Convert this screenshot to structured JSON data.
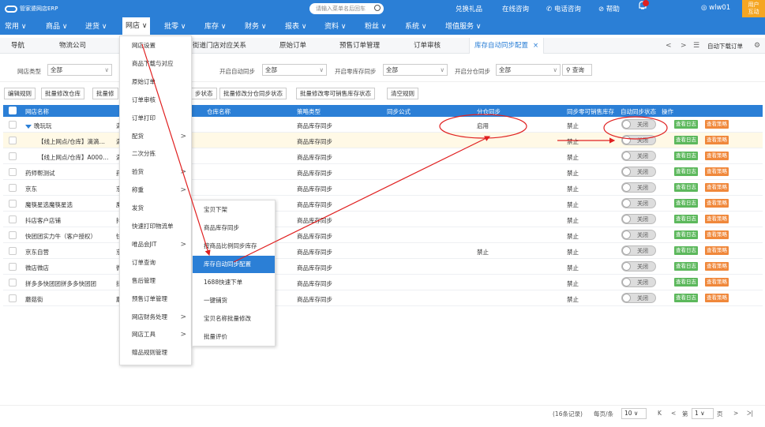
{
  "app": {
    "logo": "管家婆网店ERP"
  },
  "topbar": {
    "search_placeholder": "请输入菜单名后回车",
    "links": [
      "兑换礼品",
      "在线咨询",
      "电话咨询",
      "帮助"
    ],
    "user": "wlw01",
    "interact": [
      "用户",
      "互动"
    ]
  },
  "menu": [
    "常用",
    "商品",
    "进货",
    "网店",
    "批零",
    "库存",
    "财务",
    "报表",
    "资料",
    "粉丝",
    "系统",
    "增值服务"
  ],
  "tabs": [
    "导航",
    "物流公司",
    "街道门店对应关系",
    "原始订单",
    "预售订单管理",
    "订单审核",
    "库存自动同步配置"
  ],
  "tab_close": "×",
  "tab_controls": {
    "prev": "<",
    "next": ">",
    "list": "☰",
    "auto_download": "自动下载订单",
    "settings": "⚙"
  },
  "filters": [
    {
      "label": "网店类型",
      "value": "全部"
    },
    {
      "label": "开启自动同步",
      "value": "全部"
    },
    {
      "label": "开启零库存同步",
      "value": "全部"
    },
    {
      "label": "开启分仓同步",
      "value": "全部"
    }
  ],
  "query_label": "查询",
  "actions": [
    "编辑规则",
    "批量修改仓库",
    "批量修",
    "步状态",
    "批量修改分仓同步状态",
    "批量修改零可销售库存状态",
    "清空规则"
  ],
  "columns": [
    "网店名称",
    "仓库名称",
    "策略类型",
    "同步公式",
    "分仓同步",
    "同步零可销售库存",
    "自动同步状态",
    "操作"
  ],
  "rows": [
    {
      "name": "晚玩玩",
      "c2": "满",
      "strategy": "商品库存同步",
      "split": "启用",
      "zero": "禁止",
      "toggle": "关闭",
      "group": true
    },
    {
      "name": "【线上网点/仓库】滴滴…",
      "c2": "满",
      "strategy": "商品库存同步",
      "split": "",
      "zero": "禁止",
      "toggle": "关闭",
      "child": true
    },
    {
      "name": "【线上网点/仓库】A000…",
      "c2": "满",
      "strategy": "商品库存同步",
      "split": "",
      "zero": "禁止",
      "toggle": "关闭",
      "child": true
    },
    {
      "name": "药师帮测试",
      "c2": "药",
      "strategy": "商品库存同步",
      "split": "",
      "zero": "禁止",
      "toggle": "关闭"
    },
    {
      "name": "京东",
      "c2": "京",
      "strategy": "商品库存同步",
      "split": "",
      "zero": "禁止",
      "toggle": "关闭"
    },
    {
      "name": "魔筷星选魔筷星选",
      "c2": "魔",
      "strategy": "商品库存同步",
      "split": "",
      "zero": "禁止",
      "toggle": "关闭"
    },
    {
      "name": "抖店客户店铺",
      "c2": "抖",
      "strategy": "商品库存同步",
      "split": "",
      "zero": "禁止",
      "toggle": "关闭"
    },
    {
      "name": "快团团实力牛（客户授权）",
      "c2": "快",
      "strategy": "商品库存同步",
      "split": "",
      "zero": "禁止",
      "toggle": "关闭"
    },
    {
      "name": "京东自营",
      "c2": "京",
      "strategy": "商品库存同步",
      "split": "禁止",
      "zero": "禁止",
      "toggle": "关闭"
    },
    {
      "name": "微店微店",
      "c2": "微",
      "strategy": "商品库存同步",
      "split": "",
      "zero": "禁止",
      "toggle": "关闭"
    },
    {
      "name": "拼多多快团团拼多多快团团",
      "c2": "拼",
      "strategy": "商品库存同步",
      "split": "",
      "zero": "禁止",
      "toggle": "关闭"
    },
    {
      "name": "蘑菇街",
      "c2": "蘑",
      "strategy": "商品库存同步",
      "split": "",
      "zero": "禁止",
      "toggle": "关闭"
    }
  ],
  "row_actions": {
    "log": "查看日志",
    "policy": "查看策略"
  },
  "dropdown1": [
    {
      "label": "网店设置"
    },
    {
      "label": "商品下载与对应"
    },
    {
      "label": "原始订单"
    },
    {
      "label": "订单审核"
    },
    {
      "label": "订单打印"
    },
    {
      "label": "配货",
      "arrow": true
    },
    {
      "label": "二次分拣"
    },
    {
      "label": "验货",
      "arrow": true
    },
    {
      "label": "称重",
      "arrow": true
    },
    {
      "label": "发货"
    },
    {
      "label": "快速打印物流单"
    },
    {
      "label": "唯品会JIT",
      "arrow": true
    },
    {
      "label": "订单查询"
    },
    {
      "label": "售后管理"
    },
    {
      "label": "预售订单管理"
    },
    {
      "label": "网店财务处理",
      "arrow": true
    },
    {
      "label": "网店工具",
      "arrow": true
    },
    {
      "label": "赠品规则管理"
    }
  ],
  "dropdown2": [
    "宝贝下架",
    "商品库存同步",
    "按商品比例同步库存",
    "库存自动同步配置",
    "1688快速下单",
    "一键铺货",
    "宝贝名称批量修改",
    "批量评价"
  ],
  "pager": {
    "records": "(16条记录)",
    "per_page_label": "每页/条",
    "per_page": "10",
    "first": "K",
    "prev": "<",
    "page_label": "第",
    "page": "1",
    "page_suffix": "页",
    "next": ">",
    "last": "ᐳ|"
  }
}
